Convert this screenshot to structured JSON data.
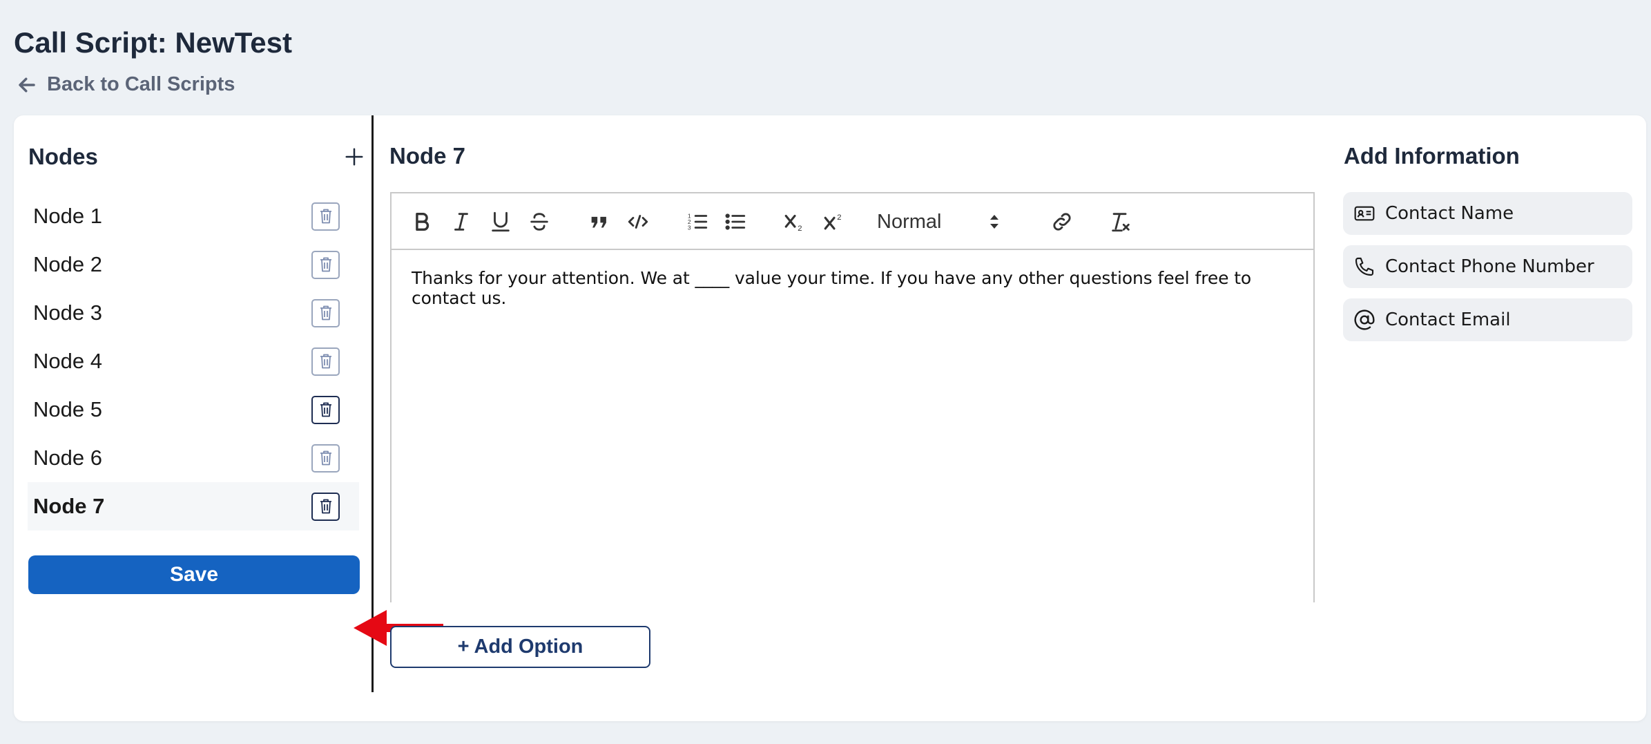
{
  "page": {
    "title": "Call Script: NewTest",
    "back_label": "Back to Call Scripts"
  },
  "nodes_panel": {
    "title": "Nodes",
    "items": [
      {
        "label": "Node 1"
      },
      {
        "label": "Node 2"
      },
      {
        "label": "Node 3"
      },
      {
        "label": "Node 4"
      },
      {
        "label": "Node 5"
      },
      {
        "label": "Node 6"
      },
      {
        "label": "Node 7"
      }
    ],
    "active_item": "Node 7",
    "save_label": "Save"
  },
  "editor": {
    "heading": "Node 7",
    "toolbar": {
      "format_value": "Normal",
      "buttons": [
        "bold-icon",
        "italic-icon",
        "underline-icon",
        "strikethrough-icon",
        "blockquote-icon",
        "code-icon",
        "ordered-list-icon",
        "bullet-list-icon",
        "subscript-icon",
        "superscript-icon",
        "link-icon",
        "clear-format-icon"
      ]
    },
    "content": "Thanks for your attention. We at ____ value your time. If you have any other questions feel free to contact us.",
    "add_option_label": "+ Add Option"
  },
  "info_panel": {
    "title": "Add Information",
    "items": [
      {
        "label": "Contact Name",
        "icon": "contact-card-icon"
      },
      {
        "label": "Contact Phone Number",
        "icon": "phone-icon"
      },
      {
        "label": "Contact Email",
        "icon": "at-sign-icon"
      }
    ]
  },
  "colors": {
    "primary": "#1563c1",
    "annotation_arrow": "#e50914",
    "background": "#edf1f5"
  }
}
